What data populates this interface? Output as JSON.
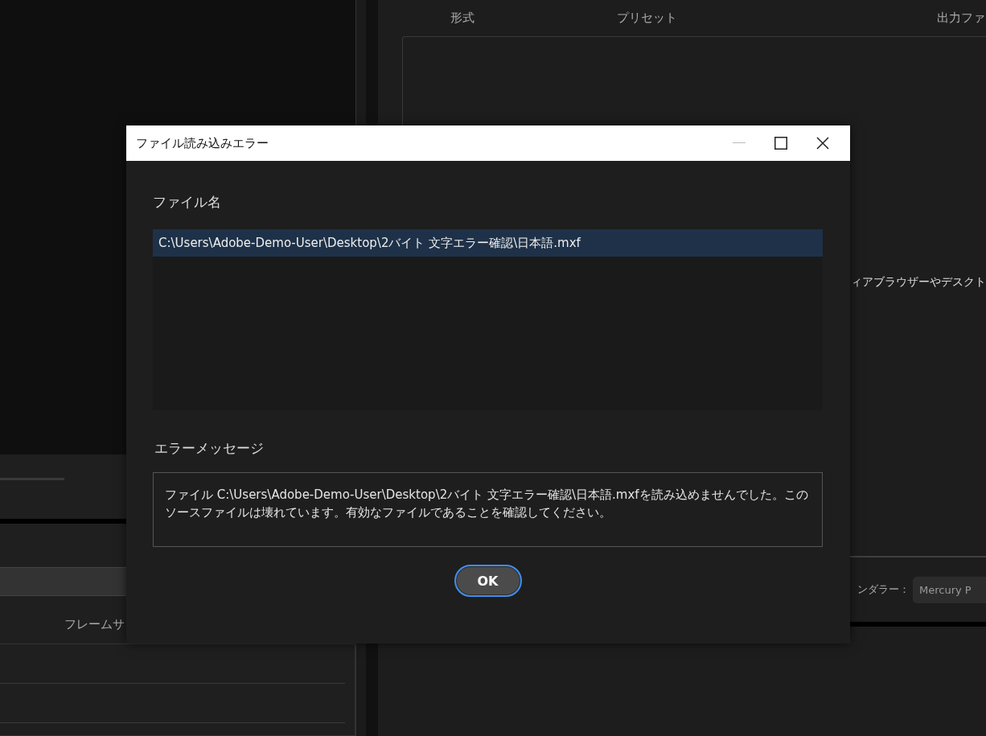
{
  "background": {
    "columns": [
      "形式",
      "プリセット",
      "出力ファ"
    ],
    "hint": "ィアブラウザーやデスクト",
    "renderer_label": "ンダラー：",
    "renderer_value": "Mercury P",
    "frame_size_label": "フレームサ"
  },
  "dialog": {
    "title": "ファイル読み込みエラー",
    "file_label": "ファイル名",
    "files": [
      {
        "path": "C:\\Users\\Adobe-Demo-User\\Desktop\\2バイト 文字エラー確認\\日本語.mxf",
        "selected": true
      }
    ],
    "message_label": "エラーメッセージ",
    "message": "ファイル C:\\Users\\Adobe-Demo-User\\Desktop\\2バイト 文字エラー確認\\日本語.mxfを読み込めませんでした。このソースファイルは壊れています。有効なファイルであることを確認してください。",
    "buttons": [
      {
        "label": "OK",
        "focused": true
      }
    ]
  }
}
